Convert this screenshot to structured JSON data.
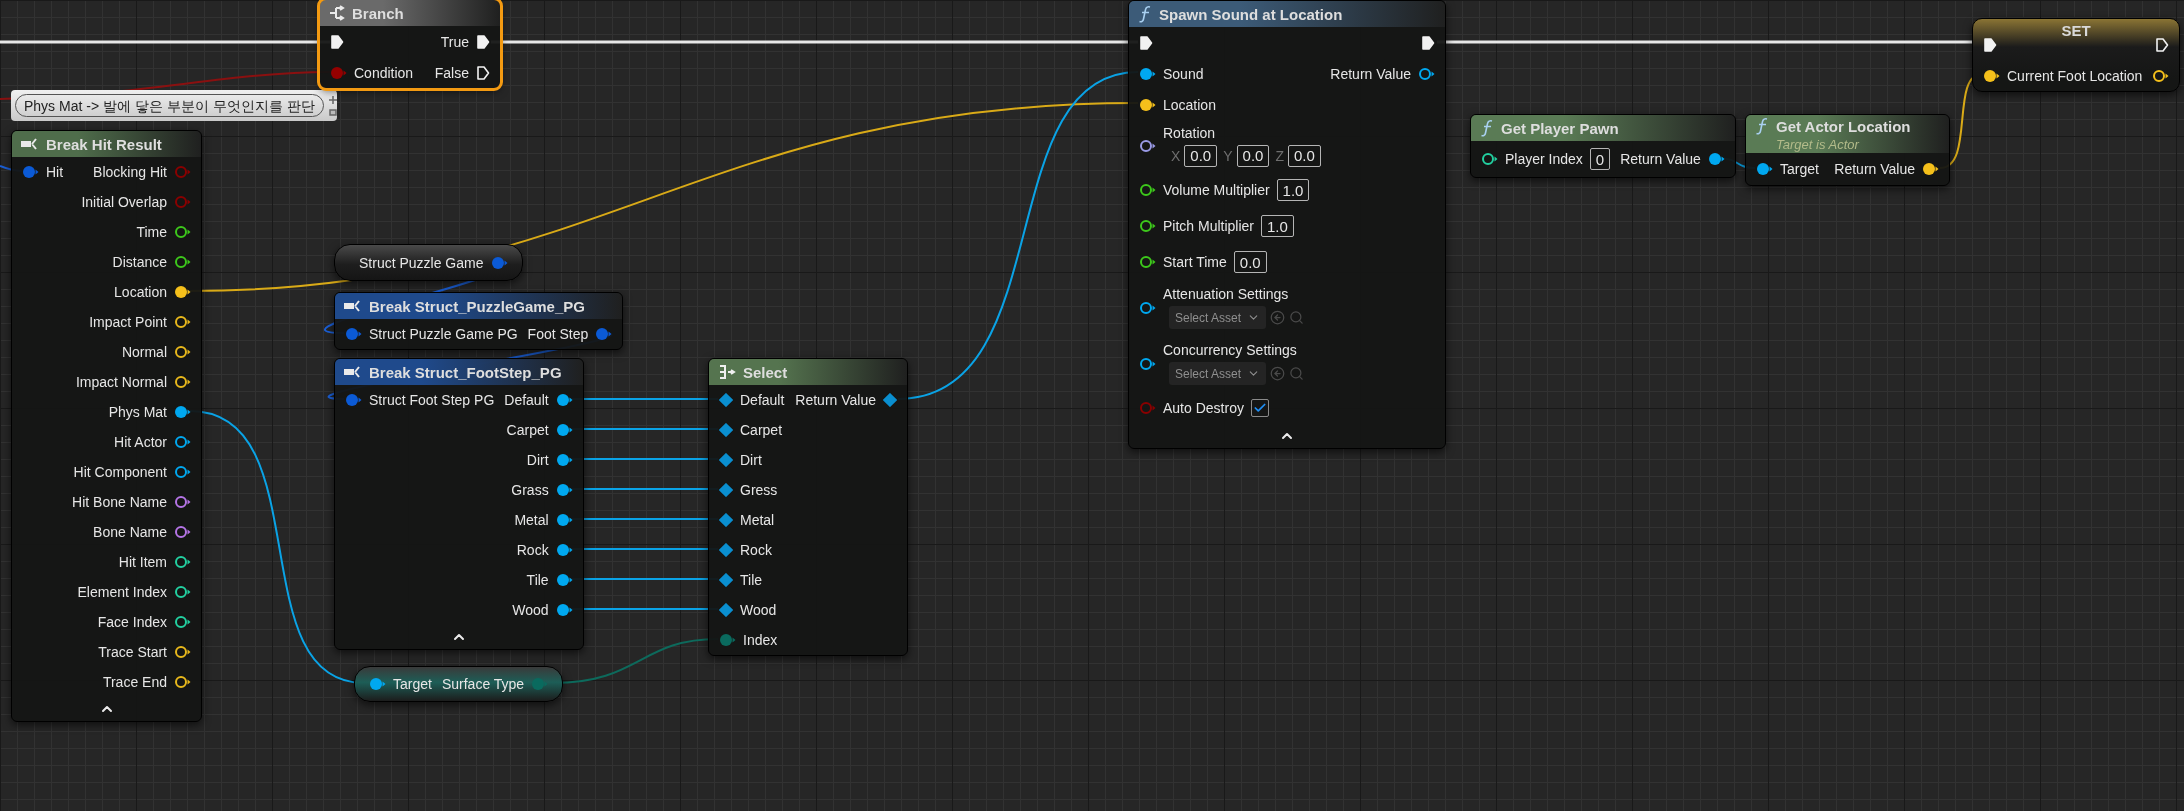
{
  "comment": {
    "text": "Phys Mat -> 발에 닿은 부분이 무엇인지를 판단"
  },
  "nodes": [
    {
      "kind": "branch",
      "title": "Branch",
      "color": "#6a6a6a",
      "selected": true,
      "advanced_toggle": false,
      "rows": [
        {
          "left": {
            "kind": "exec",
            "connected": true
          },
          "right": {
            "kind": "exec",
            "label": "True",
            "connected": true
          }
        },
        {
          "left": {
            "kind": "data",
            "label": "Condition",
            "color": "#950000",
            "connected": true
          },
          "right": {
            "kind": "exec",
            "label": "False",
            "connected": false
          }
        }
      ]
    },
    {
      "kind": "break",
      "title": "Break Hit Result",
      "color": "#4f6d4b",
      "selected": false,
      "advanced_toggle": true,
      "rows": [
        {
          "left": {
            "kind": "data",
            "label": "Hit",
            "color": "#0b5ad6",
            "connected": true
          },
          "right": {
            "kind": "data",
            "label": "Blocking Hit",
            "color": "#8a0000",
            "connected": false
          }
        },
        {
          "right": {
            "kind": "data",
            "label": "Initial Overlap",
            "color": "#8a0000",
            "connected": false
          }
        },
        {
          "right": {
            "kind": "data",
            "label": "Time",
            "color": "#3dc81b",
            "connected": false
          }
        },
        {
          "right": {
            "kind": "data",
            "label": "Distance",
            "color": "#3dc81b",
            "connected": false
          }
        },
        {
          "right": {
            "kind": "data",
            "label": "Location",
            "color": "#f5c01b",
            "connected": true
          }
        },
        {
          "right": {
            "kind": "data",
            "label": "Impact Point",
            "color": "#e8b81b",
            "connected": false
          }
        },
        {
          "right": {
            "kind": "data",
            "label": "Normal",
            "color": "#e8b81b",
            "connected": false
          }
        },
        {
          "right": {
            "kind": "data",
            "label": "Impact Normal",
            "color": "#e8b81b",
            "connected": false
          }
        },
        {
          "right": {
            "kind": "data",
            "label": "Phys Mat",
            "color": "#00a8f0",
            "connected": true
          }
        },
        {
          "right": {
            "kind": "data",
            "label": "Hit Actor",
            "color": "#00a8f0",
            "connected": false
          }
        },
        {
          "right": {
            "kind": "data",
            "label": "Hit Component",
            "color": "#00a8f0",
            "connected": false
          }
        },
        {
          "right": {
            "kind": "data",
            "label": "Hit Bone Name",
            "color": "#b574e6",
            "connected": false
          }
        },
        {
          "right": {
            "kind": "data",
            "label": "Bone Name",
            "color": "#b574e6",
            "connected": false
          }
        },
        {
          "right": {
            "kind": "data",
            "label": "Hit Item",
            "color": "#22d0a0",
            "connected": false
          }
        },
        {
          "right": {
            "kind": "data",
            "label": "Element Index",
            "color": "#22d0a0",
            "connected": false
          }
        },
        {
          "right": {
            "kind": "data",
            "label": "Face Index",
            "color": "#22d0a0",
            "connected": false
          }
        },
        {
          "right": {
            "kind": "data",
            "label": "Trace Start",
            "color": "#e8b81b",
            "connected": false
          }
        },
        {
          "right": {
            "kind": "data",
            "label": "Trace End",
            "color": "#e8b81b",
            "connected": false
          }
        }
      ]
    },
    {
      "kind": "variable",
      "selected": false,
      "advanced_toggle": false,
      "rows": [
        {
          "right": {
            "kind": "data",
            "label": "Struct Puzzle Game",
            "color": "#0b5ad6",
            "connected": true
          }
        }
      ]
    },
    {
      "kind": "break",
      "title": "Break Struct_PuzzleGame_PG",
      "color": "#1f4a8c",
      "selected": false,
      "advanced_toggle": false,
      "rows": [
        {
          "left": {
            "kind": "data",
            "label": "Struct Puzzle Game PG",
            "color": "#0b5ad6",
            "connected": true
          },
          "right": {
            "kind": "data",
            "label": "Foot Step",
            "color": "#0b5ad6",
            "connected": true
          }
        }
      ]
    },
    {
      "kind": "break",
      "title": "Break Struct_FootStep_PG",
      "color": "#1f4a8c",
      "selected": false,
      "advanced_toggle": true,
      "rows": [
        {
          "left": {
            "kind": "data",
            "label": "Struct Foot Step PG",
            "color": "#0b5ad6",
            "connected": true
          },
          "right": {
            "kind": "data",
            "label": "Default",
            "color": "#00a8f0",
            "connected": true
          }
        },
        {
          "right": {
            "kind": "data",
            "label": "Carpet",
            "color": "#00a8f0",
            "connected": true
          }
        },
        {
          "right": {
            "kind": "data",
            "label": "Dirt",
            "color": "#00a8f0",
            "connected": true
          }
        },
        {
          "right": {
            "kind": "data",
            "label": "Grass",
            "color": "#00a8f0",
            "connected": true
          }
        },
        {
          "right": {
            "kind": "data",
            "label": "Metal",
            "color": "#00a8f0",
            "connected": true
          }
        },
        {
          "right": {
            "kind": "data",
            "label": "Rock",
            "color": "#00a8f0",
            "connected": true
          }
        },
        {
          "right": {
            "kind": "data",
            "label": "Tile",
            "color": "#00a8f0",
            "connected": true
          }
        },
        {
          "right": {
            "kind": "data",
            "label": "Wood",
            "color": "#00a8f0",
            "connected": true
          }
        }
      ]
    },
    {
      "kind": "compact",
      "color": "#1d5e57",
      "selected": false,
      "advanced_toggle": false,
      "rows": [
        {
          "left": {
            "kind": "data",
            "label": "Target",
            "color": "#00a8f0",
            "connected": true
          },
          "right": {
            "kind": "data",
            "label": "Surface Type",
            "color": "#0a6a5e",
            "connected": true
          }
        }
      ]
    },
    {
      "kind": "select",
      "title": "Select",
      "color": "#55744f",
      "selected": false,
      "advanced_toggle": false,
      "rows": [
        {
          "left": {
            "kind": "diamond",
            "label": "Default",
            "color": "#0a8fd0",
            "connected": true
          },
          "right": {
            "kind": "diamond",
            "label": "Return Value",
            "color": "#0a8fd0",
            "connected": true
          }
        },
        {
          "left": {
            "kind": "diamond",
            "label": "Carpet",
            "color": "#0a8fd0",
            "connected": true
          }
        },
        {
          "left": {
            "kind": "diamond",
            "label": "Dirt",
            "color": "#0a8fd0",
            "connected": true
          }
        },
        {
          "left": {
            "kind": "diamond",
            "label": "Gress",
            "color": "#0a8fd0",
            "connected": true
          }
        },
        {
          "left": {
            "kind": "diamond",
            "label": "Metal",
            "color": "#0a8fd0",
            "connected": true
          }
        },
        {
          "left": {
            "kind": "diamond",
            "label": "Rock",
            "color": "#0a8fd0",
            "connected": true
          }
        },
        {
          "left": {
            "kind": "diamond",
            "label": "Tile",
            "color": "#0a8fd0",
            "connected": true
          }
        },
        {
          "left": {
            "kind": "diamond",
            "label": "Wood",
            "color": "#0a8fd0",
            "connected": true
          }
        },
        {
          "left": {
            "kind": "data",
            "label": "Index",
            "color": "#0a6a5e",
            "connected": true
          }
        }
      ]
    },
    {
      "kind": "function",
      "title": "Spawn Sound at Location",
      "color": "#3c5b78",
      "selected": false,
      "advanced_toggle": true,
      "rows": [
        {
          "left": {
            "kind": "exec",
            "connected": true
          },
          "right": {
            "kind": "exec",
            "connected": true
          }
        },
        {
          "left": {
            "kind": "data",
            "label": "Sound",
            "color": "#00a8f0",
            "connected": true
          },
          "right": {
            "kind": "data",
            "label": "Return Value",
            "color": "#00a8f0",
            "connected": false
          }
        },
        {
          "left": {
            "kind": "data",
            "label": "Location",
            "color": "#f5c01b",
            "connected": true
          }
        },
        {
          "left": {
            "kind": "data",
            "label": "Rotation",
            "color": "#9a9ae6",
            "connected": false,
            "vector": [
              {
                "axis": "X",
                "value": "0.0"
              },
              {
                "axis": "Y",
                "value": "0.0"
              },
              {
                "axis": "Z",
                "value": "0.0"
              }
            ]
          }
        },
        {
          "left": {
            "kind": "data",
            "label": "Volume Multiplier",
            "color": "#3dc81b",
            "connected": false,
            "value": "1.0"
          }
        },
        {
          "left": {
            "kind": "data",
            "label": "Pitch Multiplier",
            "color": "#3dc81b",
            "connected": false,
            "value": "1.0"
          }
        },
        {
          "left": {
            "kind": "data",
            "label": "Start Time",
            "color": "#3dc81b",
            "connected": false,
            "value": "0.0"
          }
        },
        {
          "left": {
            "kind": "data",
            "label": "Attenuation Settings",
            "color": "#00a8f0",
            "connected": false,
            "picker": "Select Asset"
          }
        },
        {
          "left": {
            "kind": "data",
            "label": "Concurrency Settings",
            "color": "#00a8f0",
            "connected": false,
            "picker": "Select Asset"
          }
        },
        {
          "left": {
            "kind": "data",
            "label": "Auto Destroy",
            "color": "#8a0000",
            "connected": false,
            "checked": true
          }
        }
      ]
    },
    {
      "kind": "function",
      "title": "Get Player Pawn",
      "color": "#5a7b55",
      "selected": false,
      "advanced_toggle": false,
      "rows": [
        {
          "left": {
            "kind": "data",
            "label": "Player Index",
            "color": "#22d0a0",
            "connected": false,
            "value": "0"
          },
          "right": {
            "kind": "data",
            "label": "Return Value",
            "color": "#00a8f0",
            "connected": true
          }
        }
      ]
    },
    {
      "kind": "function",
      "title": "Get Actor Location",
      "subtitle": "Target is Actor",
      "color": "#5a7b55",
      "selected": false,
      "advanced_toggle": false,
      "rows": [
        {
          "left": {
            "kind": "data",
            "label": "Target",
            "color": "#00a8f0",
            "connected": true
          },
          "right": {
            "kind": "data",
            "label": "Return Value",
            "color": "#f5c01b",
            "connected": true
          }
        }
      ]
    },
    {
      "kind": "set",
      "title": "SET",
      "color": "#8a7434",
      "selected": false,
      "advanced_toggle": false,
      "rows": [
        {
          "left": {
            "kind": "exec",
            "connected": true
          },
          "right": {
            "kind": "exec",
            "connected": false
          }
        },
        {
          "left": {
            "kind": "data",
            "label": "Current Foot Location",
            "color": "#f5c01b",
            "connected": true
          },
          "right": {
            "kind": "data",
            "color": "#f5c01b",
            "connected": false
          }
        }
      ]
    }
  ]
}
